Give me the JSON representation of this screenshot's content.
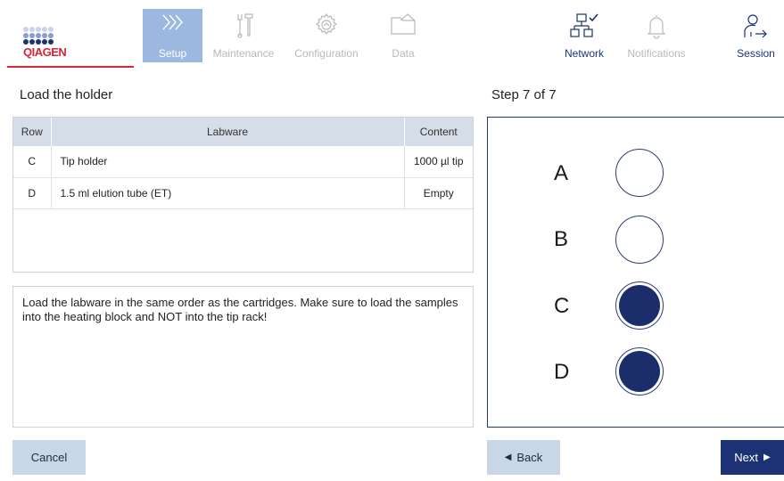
{
  "colors": {
    "brand_red": "#d6243a",
    "brand_navy": "#1c3274",
    "active_tab": "#9db8de",
    "inactive": "#b9b9b9",
    "filled_well": "#1c2d6b"
  },
  "logo": {
    "text": "QIAGEN"
  },
  "nav": {
    "tabs": [
      {
        "label": "Setup",
        "icon": "setup-chevrons-icon",
        "active": true
      },
      {
        "label": "Maintenance",
        "icon": "tools-icon",
        "active": false
      },
      {
        "label": "Configuration",
        "icon": "gear-icon",
        "active": false
      },
      {
        "label": "Data",
        "icon": "folder-icon",
        "active": false
      }
    ],
    "right": [
      {
        "label": "Network",
        "icon": "network-icon",
        "status": "connected"
      },
      {
        "label": "Notifications",
        "icon": "bell-icon"
      },
      {
        "label": "Session",
        "icon": "user-logout-icon"
      }
    ]
  },
  "main": {
    "title": "Load the holder",
    "step": "Step 7 of 7",
    "table": {
      "columns": [
        "Row",
        "Labware",
        "Content"
      ],
      "rows": [
        {
          "row": "C",
          "labware": "Tip holder",
          "content": "1000 µl tip"
        },
        {
          "row": "D",
          "labware": "1.5 ml elution tube (ET)",
          "content": "Empty"
        }
      ]
    },
    "instruction": "Load the labware in the same order as the cartridges. Make sure to load the samples into the heating block and NOT into the tip rack!"
  },
  "holder": {
    "rows": [
      {
        "letter": "A",
        "filled": false
      },
      {
        "letter": "B",
        "filled": false
      },
      {
        "letter": "C",
        "filled": true
      },
      {
        "letter": "D",
        "filled": true
      }
    ]
  },
  "buttons": {
    "cancel": "Cancel",
    "back": "Back",
    "next": "Next"
  }
}
